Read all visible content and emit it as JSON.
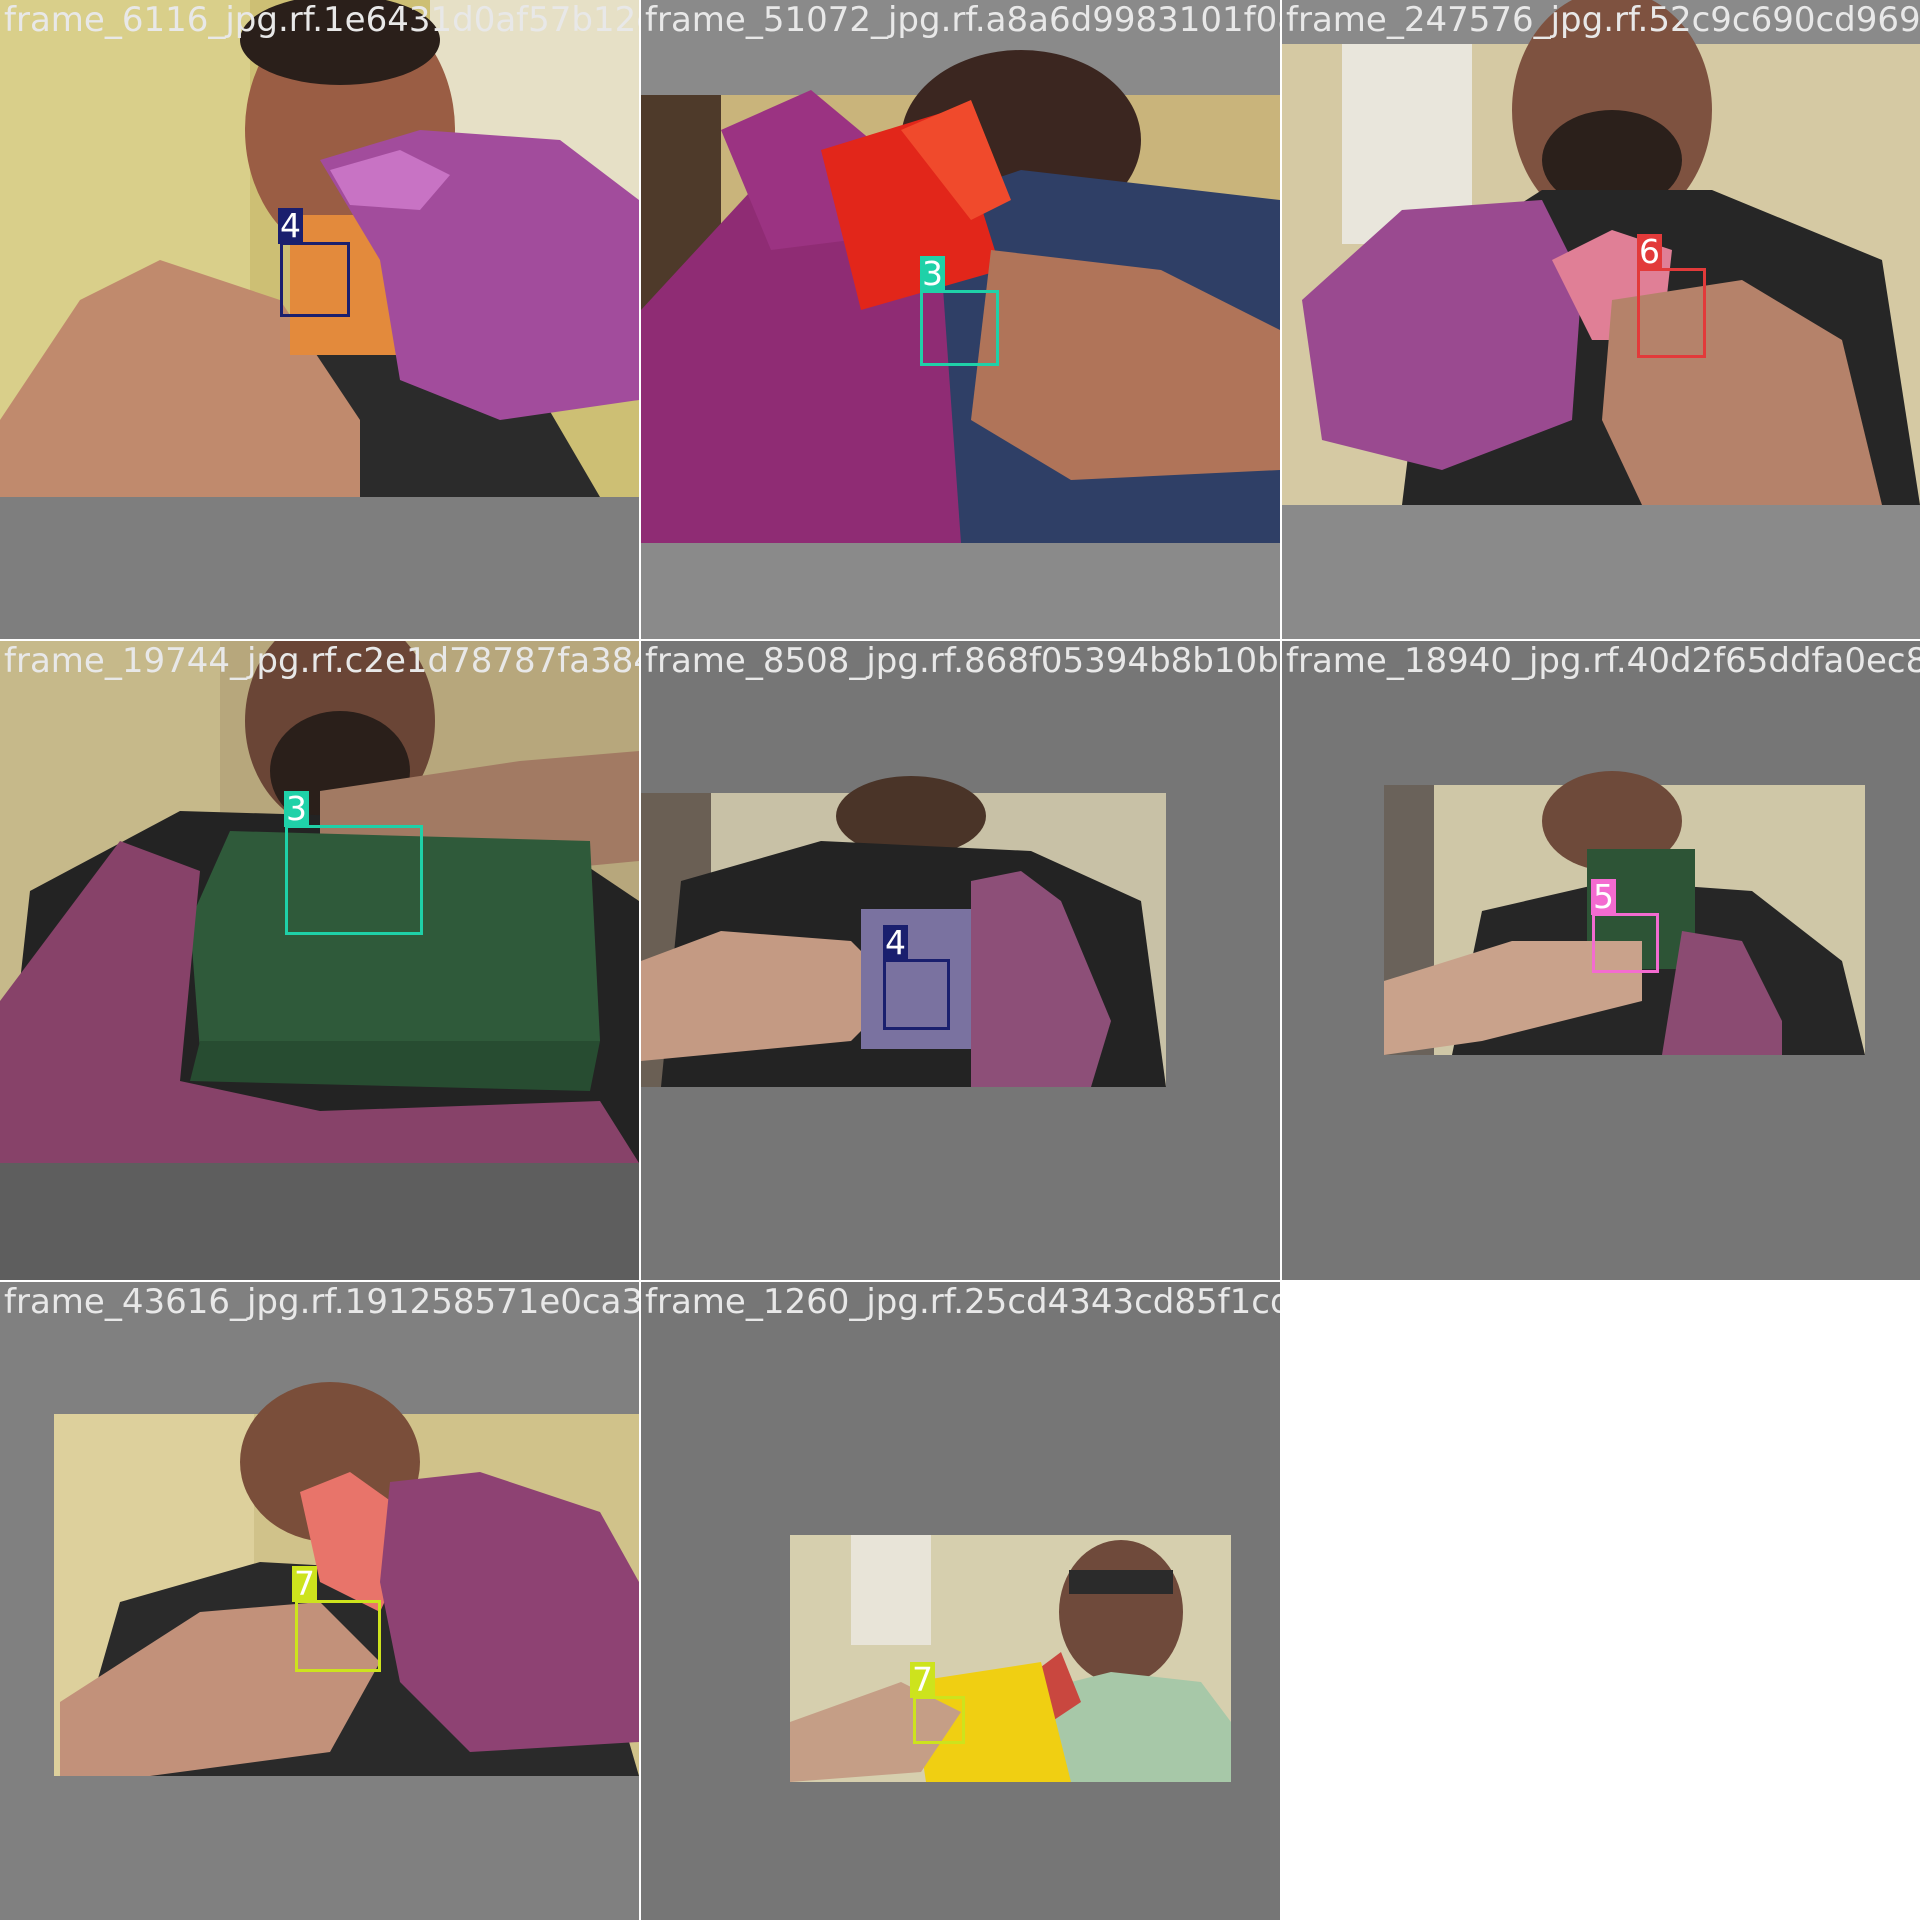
{
  "tiles": [
    {
      "filename": "frame_6116_jpg.rf.1e6431d0af57b12ef058b5",
      "class_label": "4",
      "label_color": "#1a1f6e"
    },
    {
      "filename": "frame_51072_jpg.rf.a8a6d9983101f08bb27",
      "class_label": "3",
      "label_color": "#1fd1a8"
    },
    {
      "filename": "frame_247576_jpg.rf.52c9c690cd969e",
      "class_label": "6",
      "label_color": "#e23a3a"
    },
    {
      "filename": "frame_19744_jpg.rf.c2e1d78787fa384fe427",
      "class_label": "3",
      "label_color": "#1fd1a8"
    },
    {
      "filename": "frame_8508_jpg.rf.868f05394b8b10be970e5",
      "class_label": "4",
      "label_color": "#1a1f6e"
    },
    {
      "filename": "frame_18940_jpg.rf.40d2f65ddfa0ec8",
      "class_label": "5",
      "label_color": "#f36bd0"
    },
    {
      "filename": "frame_43616_jpg.rf.191258571e0ca30b9f9a",
      "class_label": "7",
      "label_color": "#cde31d"
    },
    {
      "filename": "frame_1260_jpg.rf.25cd4343cd85f1cd748277",
      "class_label": "7",
      "label_color": "#cde31d"
    }
  ]
}
